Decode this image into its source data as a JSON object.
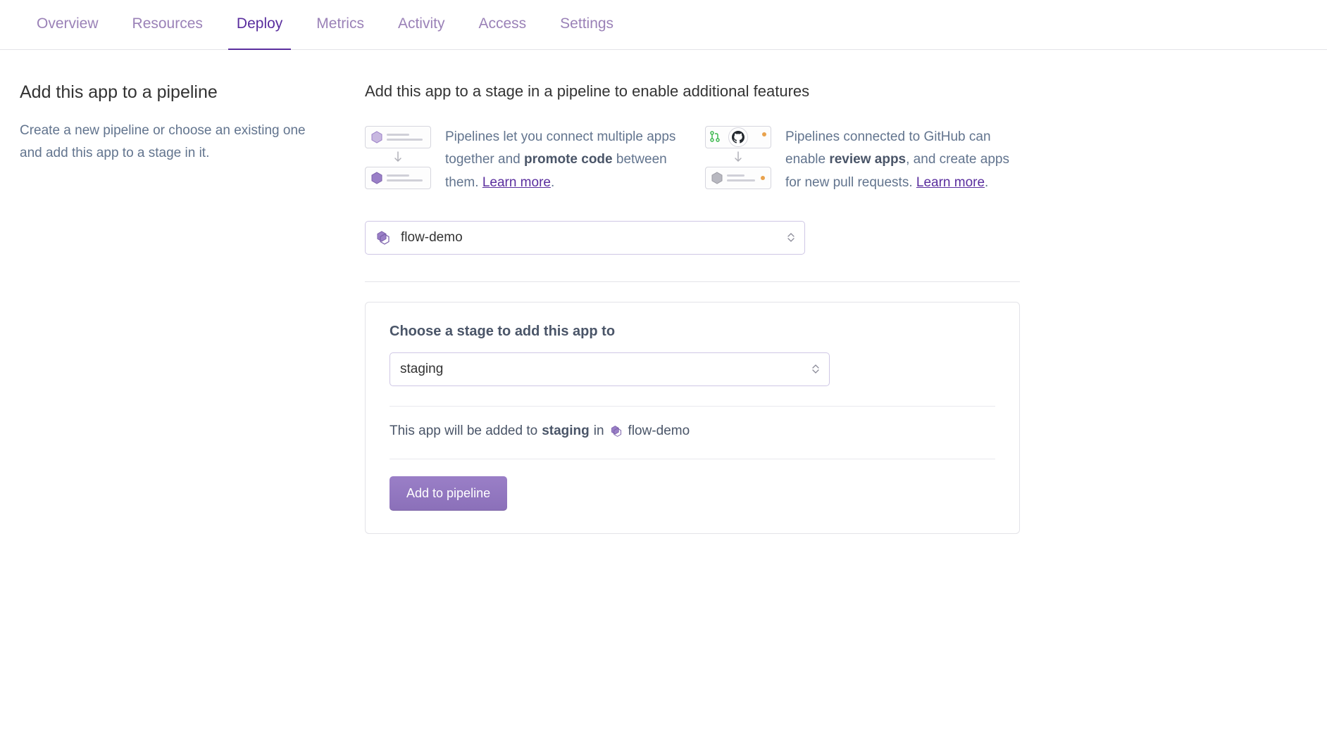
{
  "tabs": {
    "overview": "Overview",
    "resources": "Resources",
    "deploy": "Deploy",
    "metrics": "Metrics",
    "activity": "Activity",
    "access": "Access",
    "settings": "Settings"
  },
  "sidebar": {
    "title": "Add this app to a pipeline",
    "description": "Create a new pipeline or choose an existing one and add this app to a stage in it."
  },
  "main": {
    "heading": "Add this app to a stage in a pipeline to enable additional features",
    "info1_pre": "Pipelines let you connect multiple apps together and ",
    "info1_bold": "promote code",
    "info1_post": " between them. ",
    "info2_pre": "Pipelines connected to GitHub can enable ",
    "info2_bold": "review apps",
    "info2_post": ", and create apps for new pull requests. ",
    "learn_more": "Learn more",
    "pipeline_selected": "flow-demo",
    "panel": {
      "label": "Choose a stage to add this app to",
      "stage_selected": "staging",
      "summary_pre": "This app will be added to ",
      "summary_stage": "staging",
      "summary_in": " in ",
      "summary_pipeline": "flow-demo",
      "button": "Add to pipeline"
    }
  },
  "colors": {
    "purple": "#79589f",
    "purpleDark": "#5a2e9e"
  }
}
